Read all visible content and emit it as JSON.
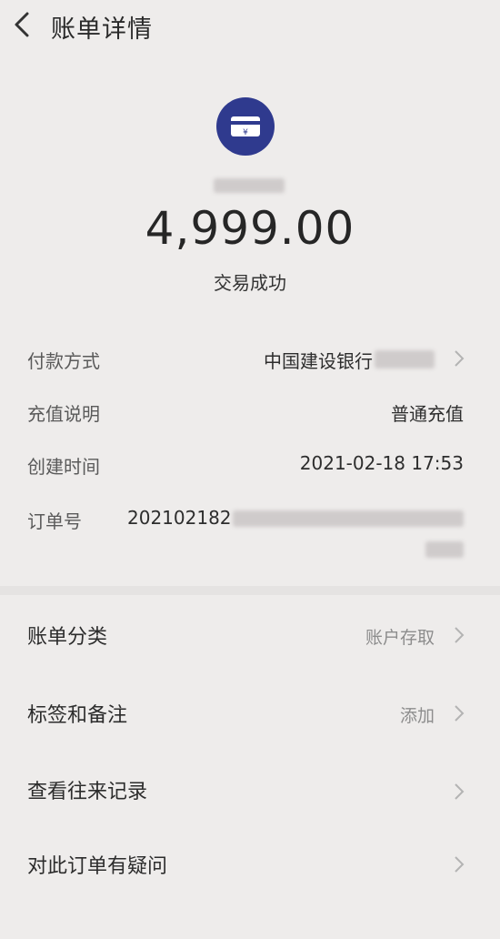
{
  "header": {
    "title": "账单详情"
  },
  "summary": {
    "amount": "4,999.00",
    "status": "交易成功"
  },
  "details": {
    "payment_method_label": "付款方式",
    "payment_method_value": "中国建设银行",
    "recharge_desc_label": "充值说明",
    "recharge_desc_value": "普通充值",
    "created_time_label": "创建时间",
    "created_time_value": "2021-02-18 17:53",
    "order_no_label": "订单号",
    "order_no_value": "202102182"
  },
  "menu": {
    "category_label": "账单分类",
    "category_value": "账户存取",
    "tags_label": "标签和备注",
    "tags_value": "添加",
    "history_label": "查看往来记录",
    "question_label": "对此订单有疑问"
  },
  "colors": {
    "icon_bg": "#2f3a8e",
    "background": "#eeeceb"
  }
}
